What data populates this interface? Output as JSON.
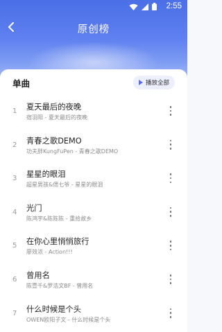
{
  "status_bar": {
    "time": "2:55"
  },
  "header": {
    "title": "原创榜"
  },
  "section": {
    "title": "单曲",
    "play_all_label": "播放全部"
  },
  "songs": [
    {
      "index": "1",
      "title": "夏天最后的夜晚",
      "subtitle": "宿羽阳 - 夏天最后的夜晚"
    },
    {
      "index": "2",
      "title": "青春之歌DEMO",
      "subtitle": "功夫胖KungFuPen - 青春之歌DEMO"
    },
    {
      "index": "3",
      "title": "星星的眼泪",
      "subtitle": "超星男孩&偲七爷 - 星星的眼泪"
    },
    {
      "index": "4",
      "title": "光门",
      "subtitle": "陈鸿宇&陈陈陈 - 重拾故乡"
    },
    {
      "index": "5",
      "title": "在你心里悄悄旅行",
      "subtitle": "廖效浓 - Action!!!"
    },
    {
      "index": "6",
      "title": "曾用名",
      "subtitle": "陈壹千&罗浩文BF - 曾用名"
    },
    {
      "index": "7",
      "title": "什么时候是个头",
      "subtitle": "OWEN欧阳子文 - 什么时候是个头"
    }
  ],
  "icons": {
    "back": "chevron-left-icon",
    "wifi": "wifi-icon",
    "signal": "signal-icon",
    "battery": "battery-icon",
    "play": "play-icon",
    "more": "more-vertical-icon"
  },
  "colors": {
    "header_top": "#4b6fe6",
    "accent": "#5b6cf0",
    "pill_bg": "#eceffd"
  }
}
